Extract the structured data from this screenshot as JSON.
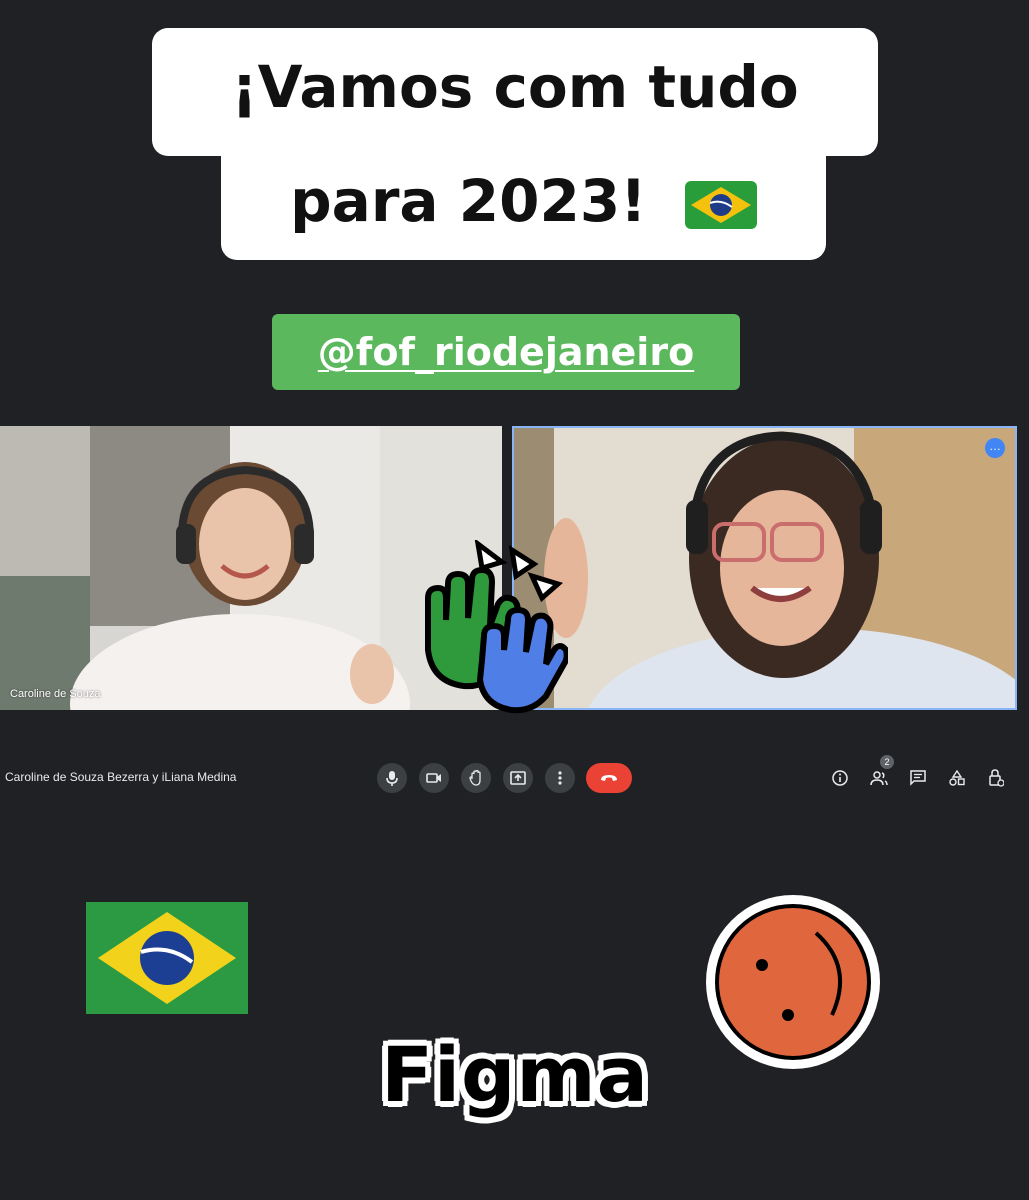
{
  "caption": {
    "line1": "¡Vamos com tudo",
    "line2": "para 2023!",
    "emoji": "brazil-flag-emoji"
  },
  "mention": "@fof_riodejaneiro",
  "call": {
    "participant_left": "Caroline de Souza",
    "meeting_participants": "Caroline de Souza Bezerra y iLiana Medina",
    "people_count": "2",
    "controls": [
      "mic-icon",
      "camera-icon",
      "raise-hand-icon",
      "present-icon",
      "more-vert-icon",
      "end-call-icon"
    ],
    "right_icons": [
      "info-icon",
      "people-icon",
      "chat-icon",
      "activities-icon",
      "host-controls-icon"
    ]
  },
  "stickers": {
    "figma": "Figma",
    "hands": "high-five-hands-sticker",
    "flag": "brazil-flag-sticker",
    "smiley": "orange-smiley-sticker"
  },
  "colors": {
    "background": "#202124",
    "mention_green": "#5cb85c",
    "end_call_red": "#ea4335",
    "active_border": "#8ab4f8",
    "smiley_orange": "#e0663d"
  }
}
